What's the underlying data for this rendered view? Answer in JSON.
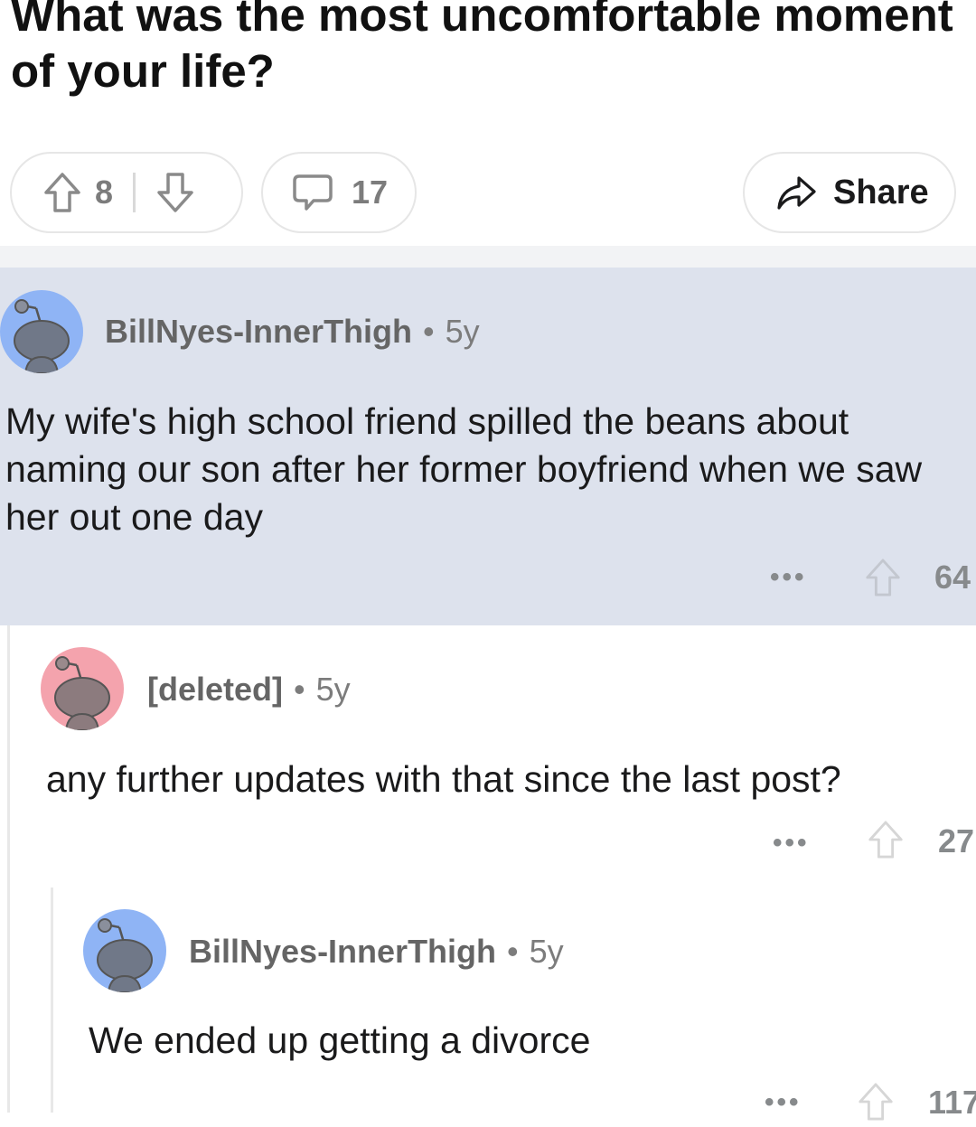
{
  "post": {
    "title": "What was the most uncomfortable moment of your life?",
    "votes": "8",
    "comments": "17",
    "share_label": "Share"
  },
  "comments": [
    {
      "username": "BillNyes-InnerThigh",
      "separator": "•",
      "age": "5y",
      "text": "My wife's high school friend spilled the beans about naming our son after her former boyfriend when we saw her out one day",
      "more": "•••",
      "score": "64",
      "avatar_color": "#8fb4f5",
      "highlighted": true
    },
    {
      "username": "[deleted]",
      "separator": "•",
      "age": "5y",
      "text": "any further updates with that since the last post?",
      "more": "•••",
      "score": "27",
      "avatar_color": "#f4a3ad"
    },
    {
      "username": "BillNyes-InnerThigh",
      "separator": "•",
      "age": "5y",
      "text": "We ended up getting a divorce",
      "more": "•••",
      "score": "117",
      "avatar_color": "#8fb4f5"
    }
  ],
  "colors": {
    "highlight_bg": "#dde2ed",
    "muted_text": "#7c7c7c",
    "pill_border": "#e6e6e6"
  },
  "icons": [
    "upvote-icon",
    "downvote-icon",
    "comment-bubble-icon",
    "share-arrow-icon",
    "snoo-avatar-icon"
  ]
}
